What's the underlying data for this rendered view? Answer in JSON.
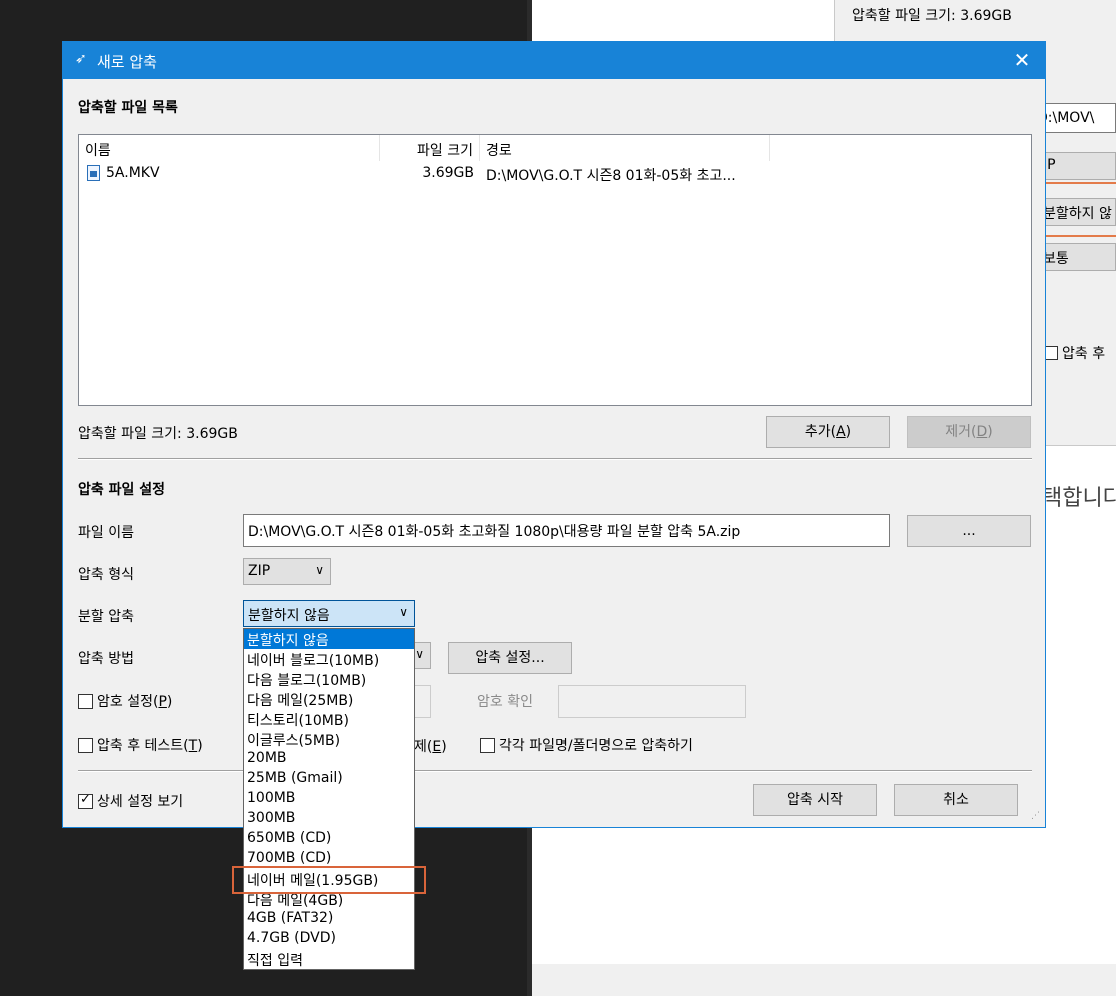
{
  "background": {
    "size_text": "압축할 파일 크기: 3.69GB",
    "path_fragment": "D:\\MOV\\",
    "format_fragment": "IP",
    "split_fragment": "분할하지 않",
    "method_fragment": "보통",
    "checkbox_fragment": "압축 후",
    "big_text_fragment": "택합니다"
  },
  "dialog": {
    "title": "새로 압축",
    "file_list_heading": "압축할 파일 목록",
    "columns": [
      "이름",
      "파일 크기",
      "경로"
    ],
    "files": [
      {
        "name": "5A.MKV",
        "size": "3.69GB",
        "path": "D:\\MOV\\G.O.T 시즌8 01화-05화 초고..."
      }
    ],
    "total_size": "압축할 파일 크기: 3.69GB",
    "add_button": {
      "label": "추가(",
      "key": "A",
      "end": ")"
    },
    "remove_button": {
      "label": "제거(",
      "key": "D",
      "end": ")"
    },
    "settings_heading": "압축 파일 설정",
    "filename_label": "파일 이름",
    "filename_value": "D:\\MOV\\G.O.T 시즌8 01화-05화 초고화질 1080p\\대용량 파일 분할 압축 5A.zip",
    "browse_label": "...",
    "format_label": "압축 형식",
    "format_value": "ZIP",
    "split_label": "분할 압축",
    "split_value": "분할하지 않음",
    "method_label": "압축 방법",
    "method_settings_label": "압축 설정...",
    "password_label": {
      "label": "암호 설정(",
      "key": "P",
      "end": ")"
    },
    "password_confirm_label": "암호 확인",
    "test_label": {
      "label": "압축 후 테스트(",
      "key": "T",
      "end": ")"
    },
    "delete_fragment": {
      "label": "제(",
      "key": "E",
      "end": ")"
    },
    "each_label": "각각 파일명/폴더명으로 압축하기",
    "detail_label": "상세 설정 보기",
    "start_button": "압축 시작",
    "cancel_button": "취소"
  },
  "split_options": [
    "분할하지 않음",
    "네이버 블로그(10MB)",
    "다음 블로그(10MB)",
    "다음 메일(25MB)",
    "티스토리(10MB)",
    "이글루스(5MB)",
    "20MB",
    "25MB (Gmail)",
    "100MB",
    "300MB",
    "650MB (CD)",
    "700MB (CD)",
    "네이버 메일(1.95GB)",
    "다음 메일(4GB)",
    "4GB (FAT32)",
    "4.7GB (DVD)",
    "직접 입력"
  ],
  "split_selected_index": 0,
  "split_highlighted_index": 12,
  "accent_color": "#1883d7",
  "highlight_color": "#d9643a"
}
